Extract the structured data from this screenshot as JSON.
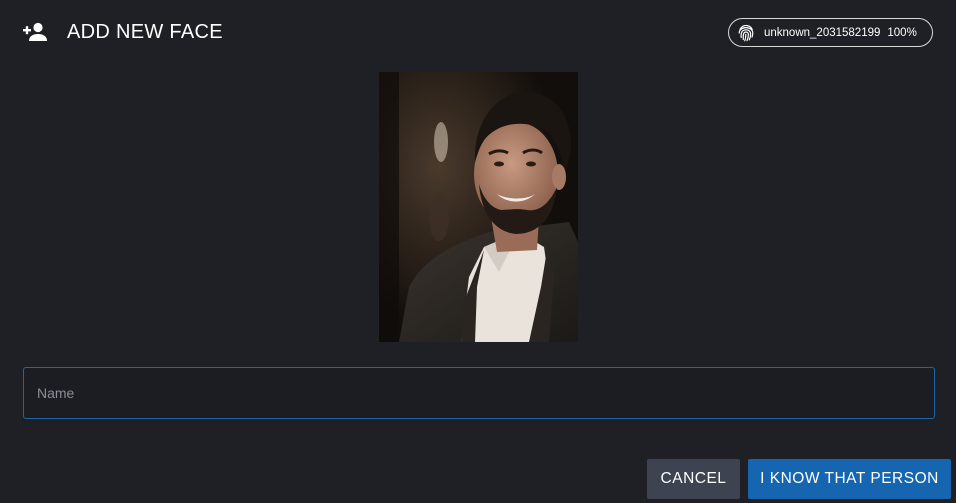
{
  "dialog": {
    "title": "ADD NEW FACE",
    "header_icon": "person-add-icon"
  },
  "badge": {
    "icon": "fingerprint-icon",
    "name": "unknown_2031582199",
    "score": "100%"
  },
  "photo": {
    "description_icon": "face-photo"
  },
  "name_input": {
    "value": "",
    "placeholder": "Name"
  },
  "actions": {
    "cancel_label": "CANCEL",
    "confirm_label": "I KNOW THAT PERSON"
  },
  "colors": {
    "background": "#1e2026",
    "input_border": "#1f66a8",
    "cancel_bg": "#3d4350",
    "confirm_bg": "#1565b0"
  }
}
